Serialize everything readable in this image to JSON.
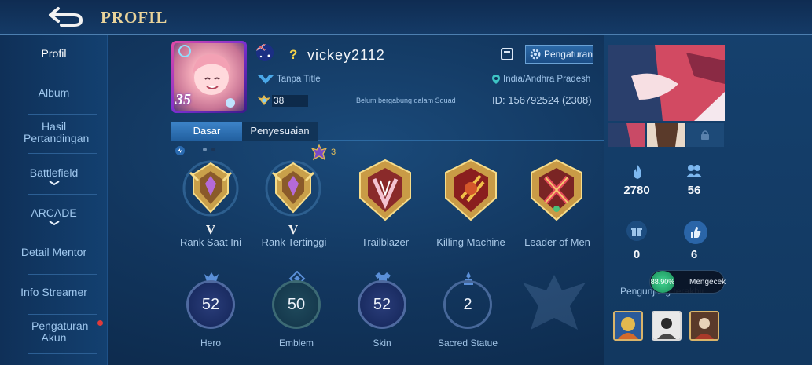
{
  "header": {
    "title": "PROFIL"
  },
  "sidebar": {
    "items": [
      {
        "label": "Profil"
      },
      {
        "label": "Album"
      },
      {
        "label": "Hasil Pertandingan"
      },
      {
        "label": "Battlefield"
      },
      {
        "label": "ARCADE"
      },
      {
        "label": "Detail Mentor"
      },
      {
        "label": "Info Streamer"
      },
      {
        "label": "Pengaturan Akun"
      }
    ]
  },
  "profile": {
    "username": "vickey2112",
    "title": "Tanpa Title",
    "location": "India/Andhra Pradesh",
    "squad": "Belum bergabung dalam Squad",
    "id_label": "ID:",
    "id_value": "156792524",
    "server": "(2308)",
    "level": "38",
    "avatar_level": "35",
    "settings_label": "Pengaturan"
  },
  "tabs": [
    {
      "label": "Dasar"
    },
    {
      "label": "Penyesuaian"
    }
  ],
  "ranks": {
    "star_count": "3",
    "current": {
      "label": "Rank Saat Ini",
      "tier": "V"
    },
    "highest": {
      "label": "Rank Tertinggi",
      "tier": "V"
    },
    "achievements": [
      {
        "label": "Trailblazer"
      },
      {
        "label": "Killing Machine"
      },
      {
        "label": "Leader of Men"
      }
    ]
  },
  "stats": [
    {
      "label": "Hero",
      "value": "52"
    },
    {
      "label": "Emblem",
      "value": "50"
    },
    {
      "label": "Skin",
      "value": "52"
    },
    {
      "label": "Sacred Statue",
      "value": "2"
    }
  ],
  "right": {
    "popularity": "2780",
    "followers": "56",
    "gifts": "0",
    "likes": "6",
    "visitors_label": "Pengunjung terakhir",
    "check_percent": "88.90%",
    "check_label": "Mengecek"
  },
  "colors": {
    "accent": "#2f74b8",
    "gold": "#e9d39a",
    "background": "#12365e"
  }
}
